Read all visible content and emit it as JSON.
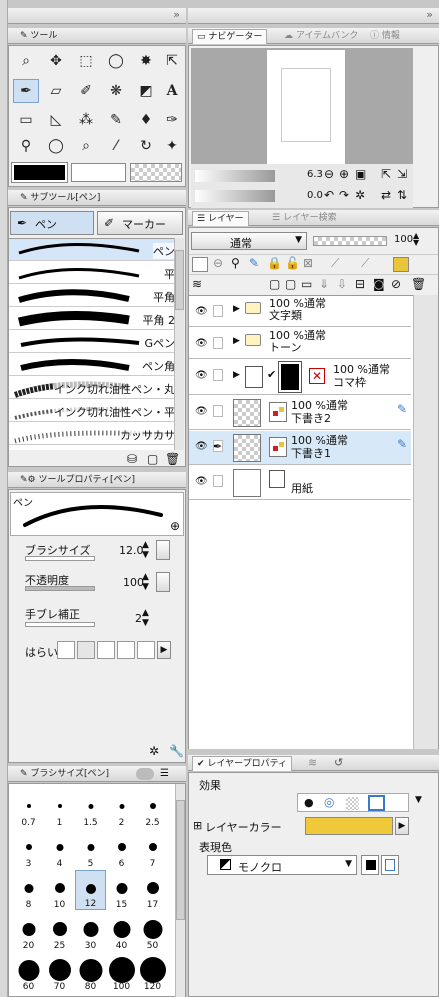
{
  "top_left": {
    "arrows": "»"
  },
  "top_right": {
    "arrows": "»"
  },
  "tool_panel": {
    "tab": "ツール"
  },
  "subtool_panel": {
    "tab": "サブツール[ペン]",
    "tab_pen": "ペン",
    "tab_marker": "マーカー",
    "brushes": [
      {
        "label": "ペン",
        "selected": true
      },
      {
        "label": "平",
        "selected": false
      },
      {
        "label": "平角",
        "selected": false
      },
      {
        "label": "平角 2",
        "selected": false
      },
      {
        "label": "Gペン",
        "selected": false
      },
      {
        "label": "ペン角",
        "selected": false
      },
      {
        "label": "インク切れ油性ペン・丸",
        "selected": false
      },
      {
        "label": "インク切れ油性ペン・平",
        "selected": false
      },
      {
        "label": "カッサカサ",
        "selected": false
      }
    ]
  },
  "tool_property": {
    "tab": "ツールプロパティ[ペン]",
    "preview_label": "ペン",
    "brush_size_label": "ブラシサイズ",
    "brush_size_value": "12.0",
    "opacity_label": "不透明度",
    "opacity_value": "100",
    "stabilization_label": "手ブレ補正",
    "stabilization_value": "2",
    "taper_label": "はらい"
  },
  "brush_size_panel": {
    "tab": "ブラシサイズ[ペン]",
    "sizes": [
      "0.7",
      "1",
      "1.5",
      "2",
      "2.5",
      "3",
      "4",
      "5",
      "6",
      "7",
      "8",
      "10",
      "12",
      "15",
      "17",
      "20",
      "25",
      "30",
      "40",
      "50",
      "60",
      "70",
      "80",
      "100",
      "120"
    ],
    "selected": "12"
  },
  "navigator": {
    "tab_nav": "ナビゲーター",
    "tab_item": "アイテムバンク",
    "tab_info": "情報",
    "zoom": "6.3",
    "rotation": "0.0"
  },
  "layer_panel": {
    "tab_layer": "レイヤー",
    "tab_search": "レイヤー検索",
    "blend_mode": "通常",
    "opacity": "100",
    "layers": [
      {
        "kind": "folder",
        "line1": "100 %通常",
        "line2": "文字類"
      },
      {
        "kind": "folder",
        "line1": "100 %通常",
        "line2": "トーン"
      },
      {
        "kind": "frame",
        "line1": "100 %通常",
        "line2": "コマ枠"
      },
      {
        "kind": "raster",
        "line1": "100 %通常",
        "line2": "下書き2"
      },
      {
        "kind": "raster",
        "line1": "100 %通常",
        "line2": "下書き1",
        "selected": true
      },
      {
        "kind": "paper",
        "line1": "",
        "line2": "用紙"
      }
    ]
  },
  "layer_property": {
    "tab": "レイヤープロパティ",
    "effect_label": "効果",
    "layer_color_label": "レイヤーカラー",
    "layer_color": "#f0c93a",
    "expression_label": "表現色",
    "expression_value": "モノクロ"
  }
}
